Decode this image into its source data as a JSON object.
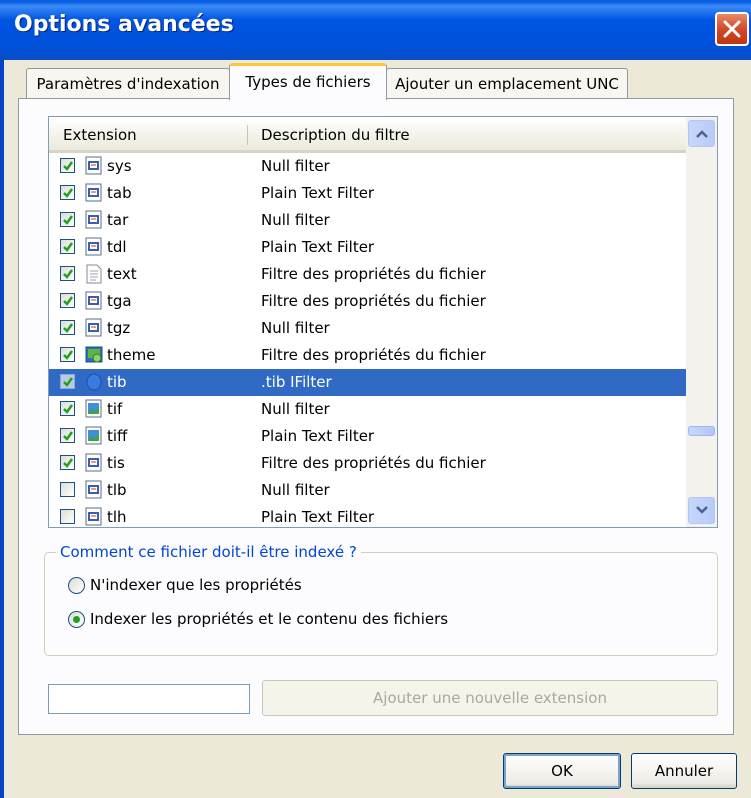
{
  "window": {
    "title": "Options avancées"
  },
  "tabs": [
    {
      "label": "Paramètres d'indexation"
    },
    {
      "label": "Types de fichiers"
    },
    {
      "label": "Ajouter un emplacement UNC"
    }
  ],
  "list": {
    "columns": {
      "extension": "Extension",
      "description": "Description du filtre"
    },
    "rows": [
      {
        "ext": "sys",
        "desc": "Null filter",
        "checked": true,
        "icon": "generic-file-icon"
      },
      {
        "ext": "tab",
        "desc": "Plain Text Filter",
        "checked": true,
        "icon": "generic-file-icon"
      },
      {
        "ext": "tar",
        "desc": "Null filter",
        "checked": true,
        "icon": "generic-file-icon"
      },
      {
        "ext": "tdl",
        "desc": "Plain Text Filter",
        "checked": true,
        "icon": "generic-file-icon"
      },
      {
        "ext": "text",
        "desc": "Filtre des propriétés du fichier",
        "checked": true,
        "icon": "text-file-icon"
      },
      {
        "ext": "tga",
        "desc": "Filtre des propriétés du fichier",
        "checked": true,
        "icon": "generic-file-icon"
      },
      {
        "ext": "tgz",
        "desc": "Null filter",
        "checked": true,
        "icon": "generic-file-icon"
      },
      {
        "ext": "theme",
        "desc": "Filtre des propriétés du fichier",
        "checked": true,
        "icon": "theme-file-icon"
      },
      {
        "ext": "tib",
        "desc": ".tib IFilter",
        "checked": true,
        "icon": "tib-file-icon",
        "selected": true
      },
      {
        "ext": "tif",
        "desc": "Null filter",
        "checked": true,
        "icon": "image-file-icon"
      },
      {
        "ext": "tiff",
        "desc": "Plain Text Filter",
        "checked": true,
        "icon": "image-file-icon"
      },
      {
        "ext": "tis",
        "desc": "Filtre des propriétés du fichier",
        "checked": true,
        "icon": "generic-file-icon"
      },
      {
        "ext": "tlb",
        "desc": "Null filter",
        "checked": false,
        "icon": "generic-file-icon"
      },
      {
        "ext": "tlh",
        "desc": "Plain Text Filter",
        "checked": false,
        "icon": "generic-file-icon"
      }
    ]
  },
  "indexing": {
    "legend": "Comment ce fichier doit-il être indexé ?",
    "options": [
      {
        "label": "N'indexer que les propriétés",
        "selected": false
      },
      {
        "label": "Indexer les propriétés et le contenu des fichiers",
        "selected": true
      }
    ]
  },
  "add_extension": {
    "input_value": "",
    "button_label": "Ajouter une nouvelle extension"
  },
  "buttons": {
    "ok": "OK",
    "cancel": "Annuler"
  },
  "colors": {
    "titlebar": "#0054e3",
    "selection": "#316ac5",
    "active_tab_accent": "#ffc73c",
    "group_title": "#0046d5"
  }
}
